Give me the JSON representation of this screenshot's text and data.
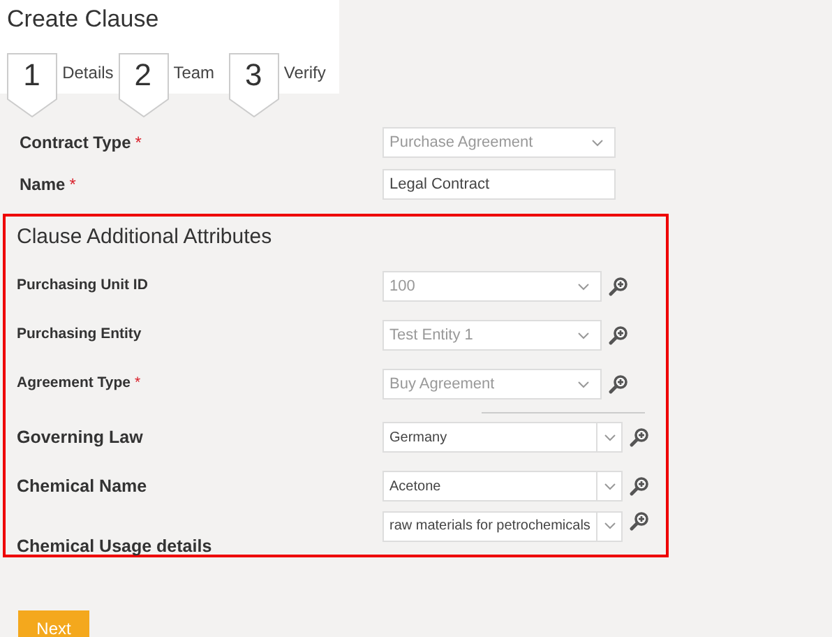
{
  "title": "Create Clause",
  "steps": [
    {
      "number": "1",
      "label": "Details"
    },
    {
      "number": "2",
      "label": "Team"
    },
    {
      "number": "3",
      "label": "Verify"
    }
  ],
  "fields": [
    {
      "label": "Contract Type",
      "required_mark": "*",
      "kind": "select",
      "value": "Purchase Agreement",
      "disabled": true
    },
    {
      "label": "Name",
      "required_mark": "*",
      "kind": "text",
      "value": "Legal Contract",
      "disabled": false
    }
  ],
  "attributes_section": {
    "heading": "Clause Additional Attributes",
    "rows": [
      {
        "label": "Purchasing Unit ID",
        "kind": "select",
        "value": "100",
        "disabled": true
      },
      {
        "label": "Purchasing Entity",
        "kind": "select",
        "value": "Test Entity 1",
        "disabled": true
      },
      {
        "label": "Agreement Type",
        "required_mark": "*",
        "kind": "select",
        "value": "Buy Agreement",
        "disabled": true
      },
      {
        "label": "Governing Law",
        "kind": "combo",
        "value": "Germany",
        "disabled": false
      },
      {
        "label": "Chemical Name",
        "kind": "combo",
        "value": "Acetone",
        "disabled": false
      },
      {
        "label": "Chemical Usage details",
        "kind": "combo",
        "value": "raw materials for petrochemicals",
        "disabled": false
      }
    ]
  },
  "next_button": "Next"
}
